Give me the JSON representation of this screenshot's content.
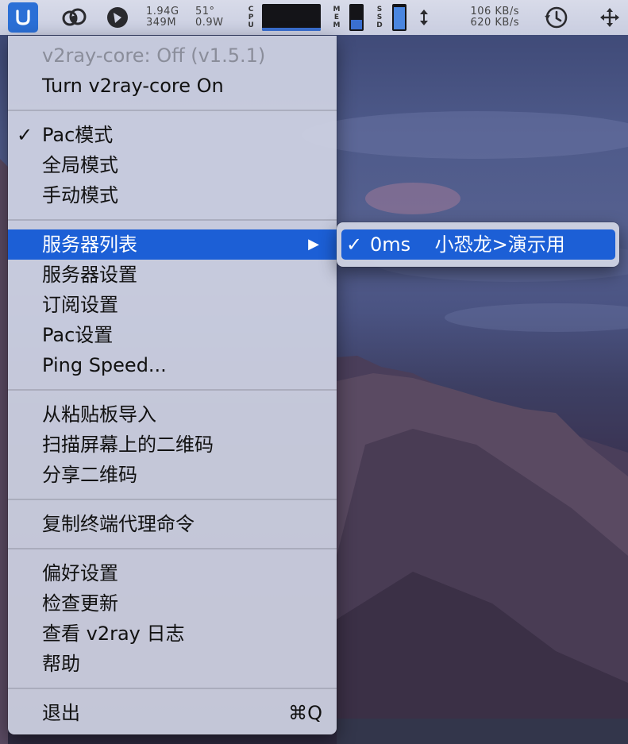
{
  "menubar": {
    "memory_line1": "1.94G",
    "memory_line2": "349M",
    "sensor_line1": "51°",
    "sensor_line2": "0.9W",
    "cpu_label": "CPU",
    "mem_label": "MEM",
    "ssd_label": "SSD",
    "net_up": "106 KB/s",
    "net_down": "620 KB/s",
    "icons": [
      "v2rayu-app-icon",
      "creative-cloud-icon",
      "shield-icon",
      "cpu-graph-icon",
      "time-machine-icon",
      "move-arrows-icon"
    ]
  },
  "main_menu": {
    "status": "v2ray-core: Off  (v1.5.1)",
    "toggle": "Turn v2ray-core On",
    "check_mark": "✓",
    "mode_pac": "Pac模式",
    "mode_global": "全局模式",
    "mode_manual": "手动模式",
    "server_list": "服务器列表",
    "submenu_arrow": "▶",
    "server_settings": "服务器设置",
    "subscription_settings": "订阅设置",
    "pac_settings": "Pac设置",
    "ping_speed": "Ping Speed...",
    "import_clipboard": "从粘贴板导入",
    "scan_qr": "扫描屏幕上的二维码",
    "share_qr": "分享二维码",
    "copy_terminal_proxy": "复制终端代理命令",
    "preferences": "偏好设置",
    "check_updates": "检查更新",
    "view_log": "查看 v2ray 日志",
    "help": "帮助",
    "quit": "退出",
    "quit_shortcut": "⌘Q"
  },
  "sub_menu": {
    "check_mark": "✓",
    "server_item": "0ms    小恐龙>演示用"
  },
  "colors": {
    "highlight": "#1c5fd6",
    "menu_bg": "#d0d4e4",
    "app_icon": "#2b6fd6"
  }
}
